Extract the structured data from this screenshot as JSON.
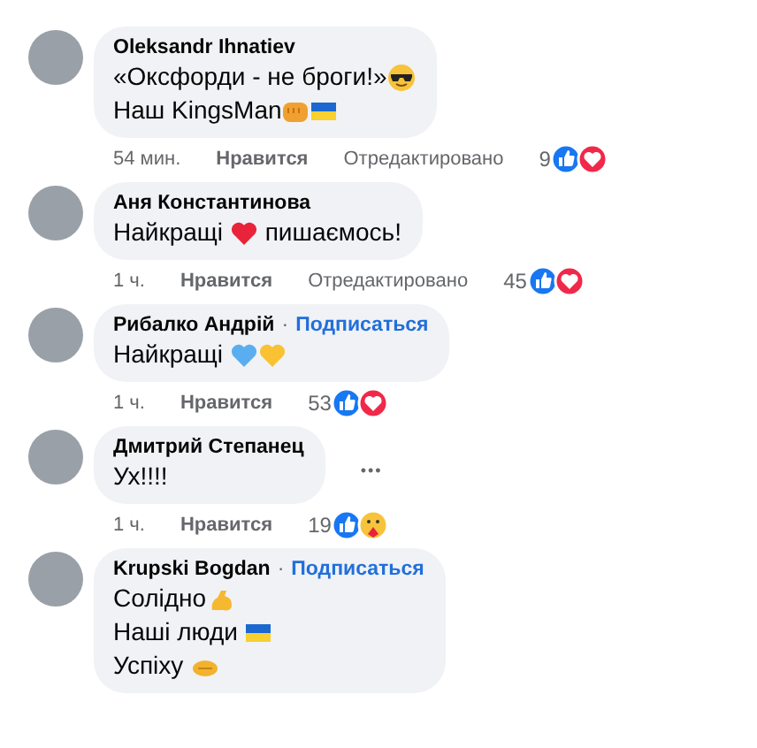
{
  "comments": [
    {
      "author": "Oleksandr Ihnatiev",
      "lines": [
        [
          {
            "kind": "text",
            "text": "«Оксфорди - не броги!»"
          },
          {
            "kind": "sunglasses"
          }
        ],
        [
          {
            "kind": "text",
            "text": "Наш KingsMan"
          },
          {
            "kind": "fist"
          },
          {
            "kind": "flag"
          }
        ]
      ],
      "time": "54 мин.",
      "like": "Нравится",
      "edited": "Отредактировано",
      "count": "9",
      "reactions": [
        {
          "kind": "like"
        },
        {
          "kind": "love"
        }
      ]
    },
    {
      "author": "Аня Константинова",
      "lines": [
        [
          {
            "kind": "text",
            "text": "Найкращі "
          },
          {
            "kind": "heart-red"
          },
          {
            "kind": "text",
            "text": " пишаємось!"
          }
        ]
      ],
      "time": "1 ч.",
      "like": "Нравится",
      "edited": "Отредактировано",
      "count": "45",
      "reactions": [
        {
          "kind": "like"
        },
        {
          "kind": "love"
        }
      ]
    },
    {
      "author": "Рибалко Андрій",
      "separator": "·",
      "follow": "Подписаться",
      "lines": [
        [
          {
            "kind": "text",
            "text": "Найкращі "
          },
          {
            "kind": "heart-blue"
          },
          {
            "kind": "heart-yellow"
          }
        ]
      ],
      "time": "1 ч.",
      "like": "Нравится",
      "count": "53",
      "reactions": [
        {
          "kind": "like"
        },
        {
          "kind": "love"
        }
      ]
    },
    {
      "author": "Дмитрий Степанец",
      "more": "•••",
      "lines": [
        [
          {
            "kind": "text",
            "text": "Ух!!!!"
          }
        ]
      ],
      "time": "1 ч.",
      "like": "Нравится",
      "count": "19",
      "reactions": [
        {
          "kind": "like"
        },
        {
          "kind": "care"
        }
      ]
    },
    {
      "author": "Krupski Bogdan",
      "separator": "·",
      "follow": "Подписаться",
      "lines": [
        [
          {
            "kind": "text",
            "text": "Солідно"
          },
          {
            "kind": "muscle"
          }
        ],
        [
          {
            "kind": "text",
            "text": "Наші люди "
          },
          {
            "kind": "flag"
          }
        ],
        [
          {
            "kind": "text",
            "text": "Успіху "
          },
          {
            "kind": "handshake"
          }
        ]
      ]
    }
  ]
}
